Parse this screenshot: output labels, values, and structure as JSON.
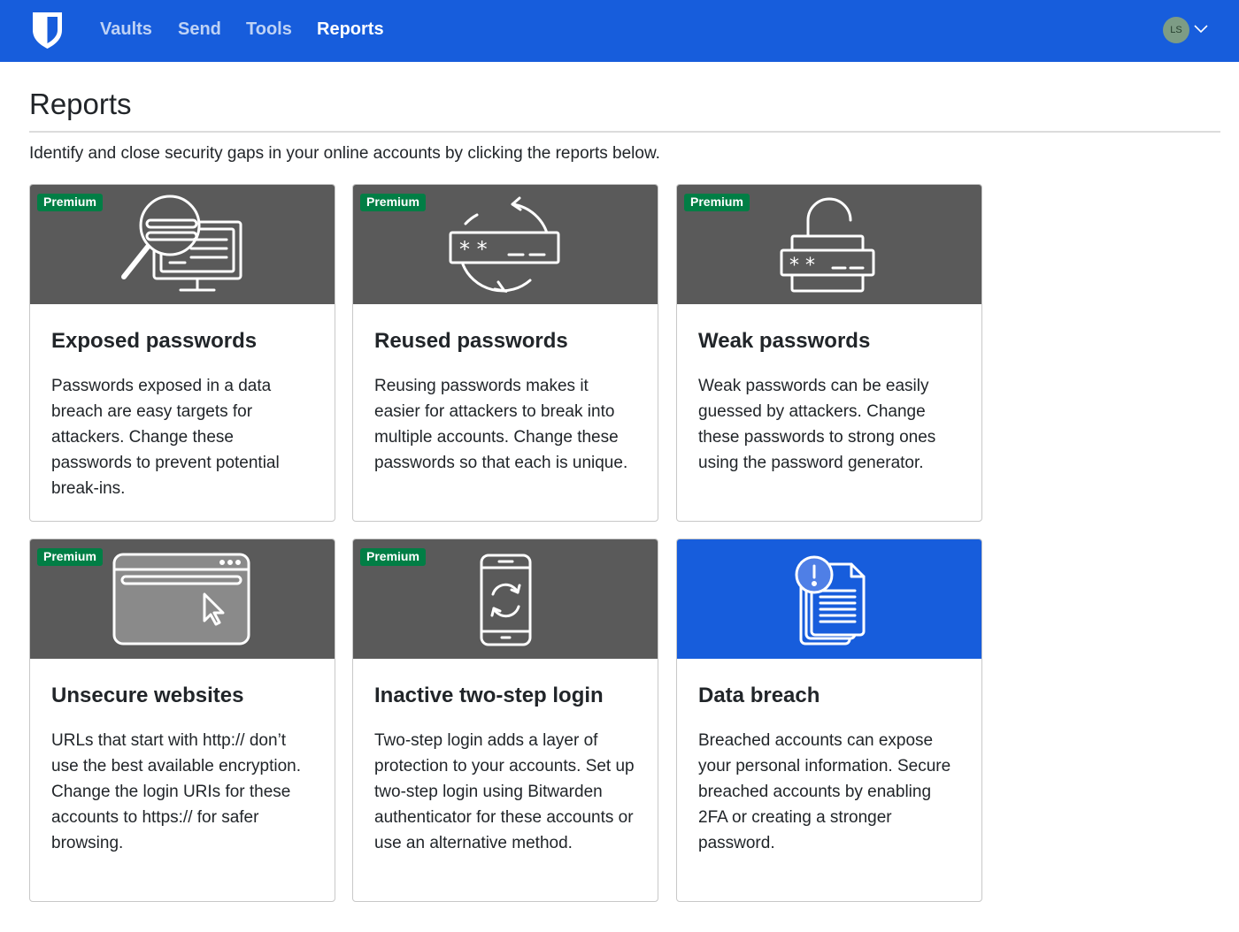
{
  "nav": {
    "items": [
      {
        "label": "Vaults",
        "active": false
      },
      {
        "label": "Send",
        "active": false
      },
      {
        "label": "Tools",
        "active": false
      },
      {
        "label": "Reports",
        "active": true
      }
    ],
    "avatar_initials": "LS"
  },
  "page": {
    "title": "Reports",
    "description": "Identify and close security gaps in your online accounts by clicking the reports below."
  },
  "cards": [
    {
      "badge": "Premium",
      "title": "Exposed passwords",
      "description": "Passwords exposed in a data breach are easy targets for attackers. Change these passwords to prevent potential break-ins.",
      "icon": "exposed-passwords-icon"
    },
    {
      "badge": "Premium",
      "title": "Reused passwords",
      "description": "Reusing passwords makes it easier for attackers to break into multiple accounts. Change these passwords so that each is unique.",
      "icon": "reused-passwords-icon"
    },
    {
      "badge": "Premium",
      "title": "Weak passwords",
      "description": "Weak passwords can be easily guessed by attackers. Change these passwords to strong ones using the password generator.",
      "icon": "weak-passwords-icon"
    },
    {
      "badge": "Premium",
      "title": "Unsecure websites",
      "description": "URLs that start with http:// don’t use the best available encryption. Change the login URIs for these accounts to https:// for safer browsing.",
      "icon": "unsecure-websites-icon"
    },
    {
      "badge": "Premium",
      "title": "Inactive two-step login",
      "description": "Two-step login adds a layer of protection to your accounts. Set up two-step login using Bitwarden authenticator for these accounts or use an alternative method.",
      "icon": "inactive-two-step-icon"
    },
    {
      "badge": "",
      "title": "Data breach",
      "description": "Breached accounts can expose your personal information. Secure breached accounts by enabling 2FA or creating a stronger password.",
      "icon": "data-breach-icon"
    }
  ],
  "colors": {
    "navbar": "#175ddc",
    "card_banner": "#5a5a5a",
    "card_banner_free": "#175ddc",
    "premium_badge": "#017e45"
  }
}
